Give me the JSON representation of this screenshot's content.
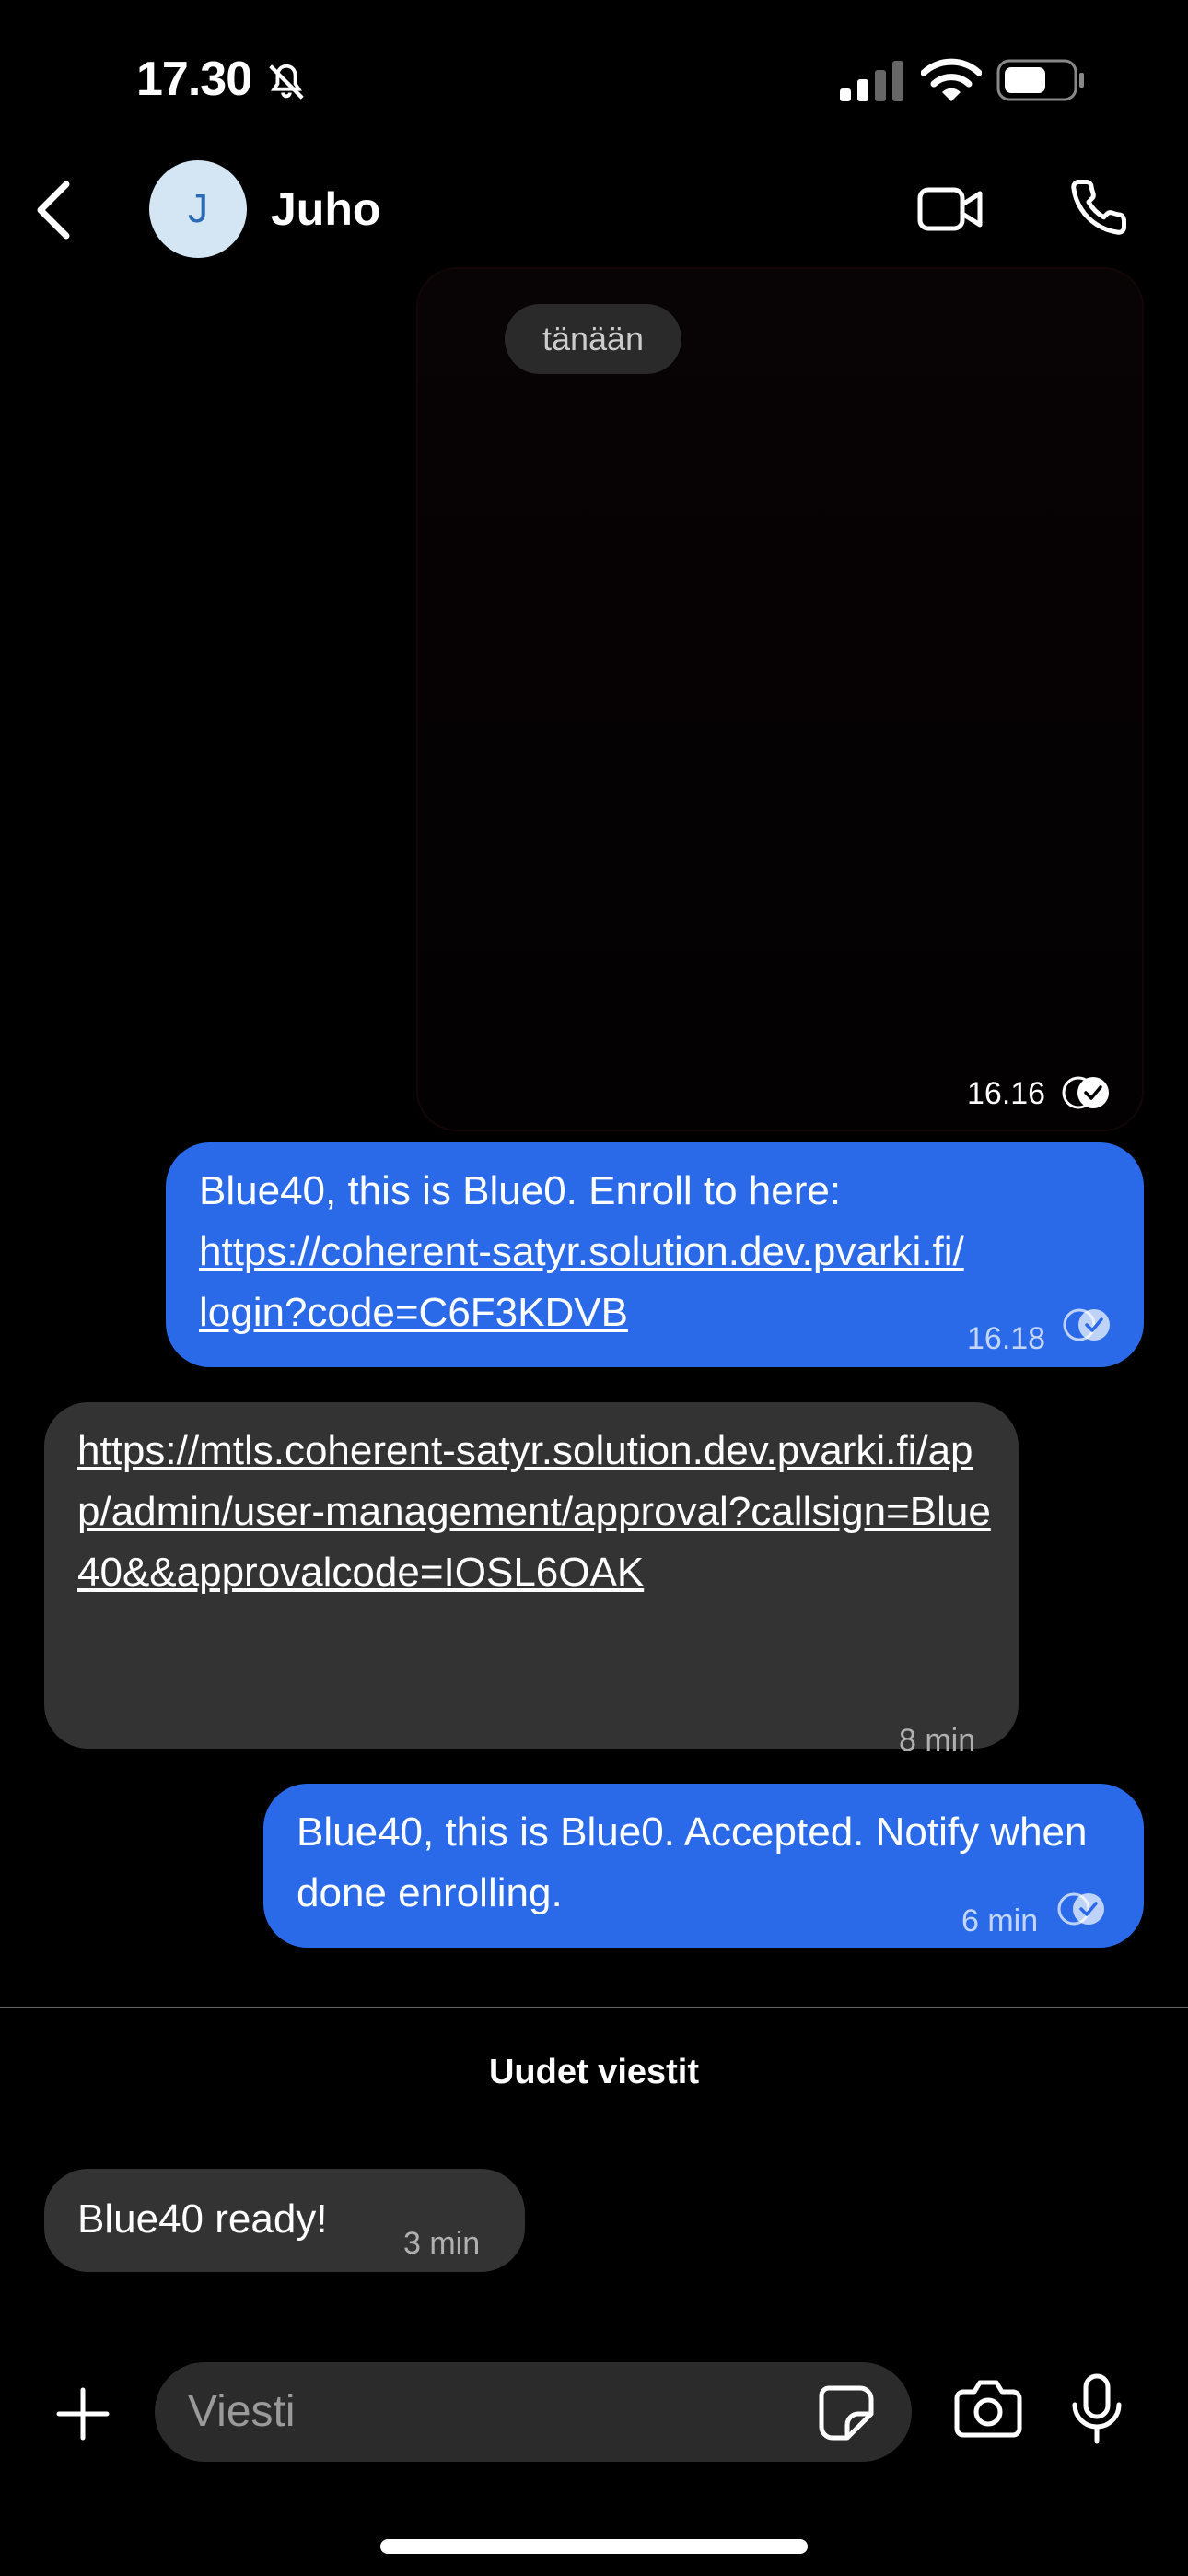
{
  "status_bar": {
    "time": "17.30"
  },
  "header": {
    "avatar_letter": "J",
    "contact_name": "Juho"
  },
  "date_divider": "tänään",
  "messages": [
    {
      "type": "media",
      "time": "16.16"
    },
    {
      "type": "outgoing",
      "line1": "Blue40, this is Blue0. Enroll to here:",
      "line2": "https://coherent-satyr.solution.dev.pvarki.fi/",
      "line3": "login?code=C6F3KDVB",
      "time": "16.18"
    },
    {
      "type": "incoming",
      "text": "https://mtls.coherent-satyr.solution.dev.pvarki.fi/app/admin/user-management/approval?callsign=Blue40&&approvalcode=IOSL6OAK",
      "time": "8 min"
    },
    {
      "type": "outgoing",
      "text": "Blue40, this is Blue0. Accepted. Notify when done enrolling.",
      "time": "6 min"
    }
  ],
  "new_messages_label": "Uudet viestit",
  "new_message": {
    "text": "Blue40 ready!",
    "time": "3 min"
  },
  "composer": {
    "placeholder": "Viesti"
  },
  "icons": {
    "back": "chevron-left-icon",
    "video": "video-call-icon",
    "phone": "phone-call-icon",
    "plus": "plus-icon",
    "sticker": "sticker-icon",
    "camera": "camera-icon",
    "mic": "microphone-icon"
  },
  "colors": {
    "outgoing_bubble": "#2a6ae8",
    "incoming_bubble": "#333333",
    "background": "#000000"
  }
}
